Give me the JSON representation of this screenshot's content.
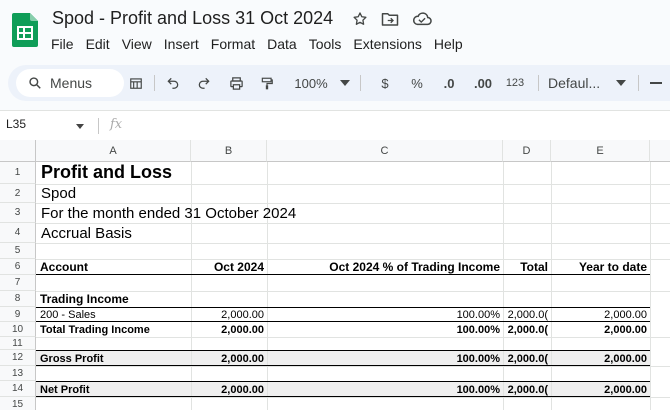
{
  "app": {
    "title": "Spod - Profit and Loss 31 Oct 2024",
    "menus": [
      "File",
      "Edit",
      "View",
      "Insert",
      "Format",
      "Data",
      "Tools",
      "Extensions",
      "Help"
    ]
  },
  "toolbar": {
    "search_label": "Menus",
    "zoom": "100%",
    "currency": "$",
    "percent": "%",
    "decrease_decimal": ".0",
    "increase_decimal": ".00",
    "number_format": "123",
    "font": "Defaul..."
  },
  "formula_bar": {
    "cell_ref": "L35",
    "fx": "fx",
    "value": ""
  },
  "sheet": {
    "columns": [
      "A",
      "B",
      "C",
      "D",
      "E"
    ],
    "rows": [
      "1",
      "2",
      "3",
      "4",
      "5",
      "6",
      "7",
      "8",
      "9",
      "10",
      "11",
      "12",
      "13",
      "14",
      "15"
    ],
    "report": {
      "title": "Profit and Loss",
      "company": "Spod",
      "period": "For the month ended 31 October 2024",
      "basis": "Accrual Basis"
    },
    "headers": {
      "account": "Account",
      "month": "Oct 2024",
      "pct": "Oct 2024 % of Trading Income",
      "total": "Total",
      "ytd": "Year to date"
    },
    "section_label": "Trading Income",
    "lines": [
      {
        "account": "200 - Sales",
        "month": "2,000.00",
        "pct": "100.00%",
        "total": "2,000.0(",
        "ytd": "2,000.00"
      },
      {
        "account": "Total Trading Income",
        "month": "2,000.00",
        "pct": "100.00%",
        "total": "2,000.0(",
        "ytd": "2,000.00"
      },
      {
        "account": "Gross Profit",
        "month": "2,000.00",
        "pct": "100.00%",
        "total": "2,000.0(",
        "ytd": "2,000.00"
      },
      {
        "account": "Net Profit",
        "month": "2,000.00",
        "pct": "100.00%",
        "total": "2,000.0(",
        "ytd": "2,000.00"
      }
    ]
  },
  "colors": {
    "sheets_green": "#0f9d58",
    "toolbar_bg": "#edf2fa",
    "header_bg": "#f8f9fa",
    "grid_line": "#e1e3e1",
    "row_shade": "#efefef"
  }
}
